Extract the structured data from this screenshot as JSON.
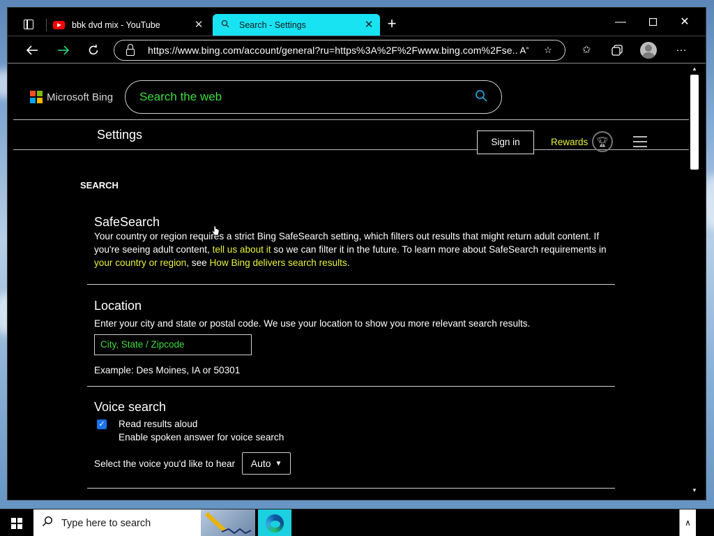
{
  "browser": {
    "tabs": [
      {
        "title": "bbk dvd mix - YouTube",
        "active": false,
        "icon": "youtube-icon"
      },
      {
        "title": "Search - Settings",
        "active": true,
        "icon": "search-icon"
      }
    ],
    "url": "https://www.bing.com/account/general?ru=https%3A%2F%2Fwww.bing.com%2Fse...",
    "accent_color": "#18e3f3"
  },
  "bing": {
    "logo_text": "Microsoft Bing",
    "search_placeholder": "Search the web",
    "settings_title": "Settings",
    "sign_in": "Sign in",
    "rewards": "Rewards"
  },
  "settings": {
    "section_label": "SEARCH",
    "safesearch": {
      "heading": "SafeSearch",
      "text_1": "Your country or region requires a strict Bing SafeSearch setting, which filters out results that might return adult content. If you're seeing adult content, ",
      "link_1": "tell us about it",
      "text_2": " so we can filter it in the future. To learn more about SafeSearch requirements in ",
      "link_2": "your country or region",
      "text_3": ", see ",
      "link_3": "How Bing delivers search results",
      "text_4": "."
    },
    "location": {
      "heading": "Location",
      "description": "Enter your city and state or postal code. We use your location to show you more relevant search results.",
      "placeholder": "City, State / Zipcode",
      "example": "Example: Des Moines, IA or 50301"
    },
    "voice": {
      "heading": "Voice search",
      "checkbox_label": "Read results aloud",
      "checkbox_sublabel": "Enable spoken answer for voice search",
      "checkbox_checked": true,
      "select_label": "Select the voice you'd like to hear",
      "select_value": "Auto"
    }
  },
  "taskbar": {
    "search_placeholder": "Type here to search"
  }
}
